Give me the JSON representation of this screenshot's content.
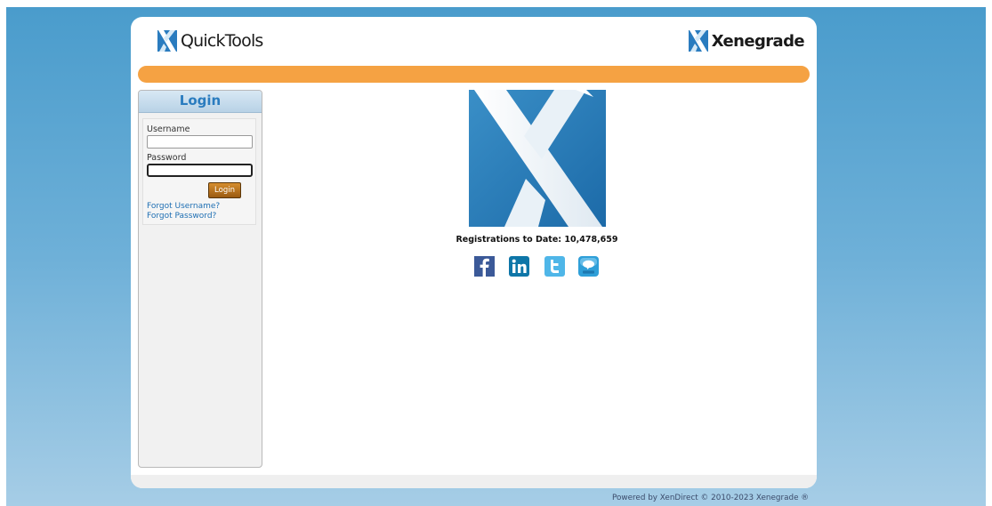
{
  "header": {
    "left_logo": {
      "text": "QuickTools",
      "icon": "x-logo-icon"
    },
    "right_logo": {
      "text": "Xenegrade",
      "icon": "x-logo-icon"
    }
  },
  "colors": {
    "accent_bar": "#f5a243",
    "background_top": "#4a9ccc",
    "background_bottom": "#a6cde6",
    "brand_blue": "#2a7cbf",
    "login_button": "#c07a22"
  },
  "sidebar": {
    "title": "Login",
    "username_label": "Username",
    "username_value": "",
    "password_label": "Password",
    "password_value": "",
    "login_button": "Login",
    "forgot_username": "Forgot Username?",
    "forgot_password": "Forgot Password?"
  },
  "main": {
    "hero_icon": "x-logo-icon",
    "registrations_text": "Registrations to Date: 10,478,659",
    "social_icons": [
      "facebook-icon",
      "linkedin-icon",
      "twitter-icon",
      "blog-icon"
    ]
  },
  "footer": {
    "text": "Powered by XenDirect © 2010-2023 Xenegrade ®"
  }
}
